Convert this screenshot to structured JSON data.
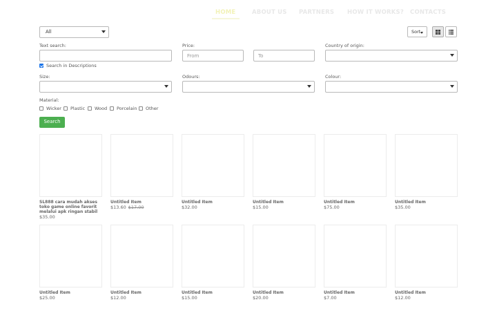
{
  "nav": {
    "items": [
      "HOME",
      "ABOUT US",
      "PARTNERS",
      "HOW IT WORKS?",
      "CONTACTS"
    ]
  },
  "toolbar": {
    "category_selected": "All",
    "sort_label": "Sort"
  },
  "filters": {
    "text_search_label": "Text search:",
    "search_in_descriptions_label": "Search in Descriptions",
    "search_in_descriptions_checked": true,
    "price_label": "Price:",
    "price_from_placeholder": "From",
    "price_to_placeholder": "To",
    "country_label": "Country of origin:",
    "size_label": "Size:",
    "odours_label": "Odours:",
    "colour_label": "Colour:",
    "material_label": "Material:",
    "materials": [
      "Wicker",
      "Plastic",
      "Wood",
      "Porcelain",
      "Other"
    ],
    "search_button": "Search"
  },
  "products": [
    {
      "title": "SL888 cara mudah akses toko game online favorit melalui apk ringan stabil",
      "price": "$35.00",
      "old_price": ""
    },
    {
      "title": "Untitled Item",
      "price": "$13.60",
      "old_price": "$17.00"
    },
    {
      "title": "Untitled Item",
      "price": "$32.00",
      "old_price": ""
    },
    {
      "title": "Untitled Item",
      "price": "$15.00",
      "old_price": ""
    },
    {
      "title": "Untitled Item",
      "price": "$75.00",
      "old_price": ""
    },
    {
      "title": "Untitled Item",
      "price": "$35.00",
      "old_price": ""
    },
    {
      "title": "Untitled Item",
      "price": "$25.00",
      "old_price": ""
    },
    {
      "title": "Untitled Item",
      "price": "$12.00",
      "old_price": ""
    },
    {
      "title": "Untitled Item",
      "price": "$15.00",
      "old_price": ""
    },
    {
      "title": "Untitled Item",
      "price": "$20.00",
      "old_price": ""
    },
    {
      "title": "Untitled Item",
      "price": "$7.00",
      "old_price": ""
    },
    {
      "title": "Untitled Item",
      "price": "$12.00",
      "old_price": ""
    }
  ]
}
